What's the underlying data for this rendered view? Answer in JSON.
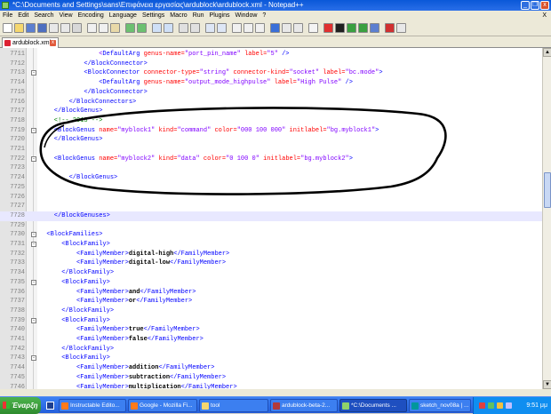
{
  "window": {
    "title": "*C:\\Documents and Settings\\sans\\Επιφάνεια εργασίας\\ardublock\\ardublock.xml - Notepad++",
    "controls": [
      "_",
      "❐",
      "x"
    ]
  },
  "menu": {
    "items": [
      "File",
      "Edit",
      "Search",
      "View",
      "Encoding",
      "Language",
      "Settings",
      "Macro",
      "Run",
      "Plugins",
      "Window",
      "?"
    ],
    "close_doc": "X"
  },
  "tab": {
    "label": "ardublock.xml",
    "close": "x"
  },
  "editor": {
    "lines": [
      {
        "n": "7711",
        "fold": "",
        "segs": [
          {
            "c": "val",
            "t": "                <"
          },
          {
            "c": "tag",
            "t": "DefaultArg "
          },
          {
            "c": "attr",
            "t": "genus-name="
          },
          {
            "c": "val",
            "t": "\"port_pin_name\" "
          },
          {
            "c": "attr",
            "t": "label="
          },
          {
            "c": "val",
            "t": "\"5\" "
          },
          {
            "c": "tag",
            "t": "/>"
          }
        ]
      },
      {
        "n": "7712",
        "fold": "",
        "segs": [
          {
            "c": "tag",
            "t": "            </BlockConnector>"
          }
        ]
      },
      {
        "n": "7713",
        "fold": "-",
        "segs": [
          {
            "c": "tag",
            "t": "            <BlockConnector "
          },
          {
            "c": "attr",
            "t": "connector-type="
          },
          {
            "c": "val",
            "t": "\"string\" "
          },
          {
            "c": "attr",
            "t": "connector-kind="
          },
          {
            "c": "val",
            "t": "\"socket\" "
          },
          {
            "c": "attr",
            "t": "label="
          },
          {
            "c": "val",
            "t": "\"bc.mode\""
          },
          {
            "c": "tag",
            "t": ">"
          }
        ]
      },
      {
        "n": "7714",
        "fold": "",
        "segs": [
          {
            "c": "tag",
            "t": "                <DefaultArg "
          },
          {
            "c": "attr",
            "t": "genus-name="
          },
          {
            "c": "val",
            "t": "\"output_mode_highpulse\" "
          },
          {
            "c": "attr",
            "t": "label="
          },
          {
            "c": "val",
            "t": "\"High Pulse\" "
          },
          {
            "c": "tag",
            "t": "/>"
          }
        ]
      },
      {
        "n": "7715",
        "fold": "",
        "segs": [
          {
            "c": "tag",
            "t": "            </BlockConnector>"
          }
        ]
      },
      {
        "n": "7716",
        "fold": "",
        "segs": [
          {
            "c": "tag",
            "t": "        </BlockConnectors>"
          }
        ]
      },
      {
        "n": "7717",
        "fold": "",
        "segs": [
          {
            "c": "tag",
            "t": "    </BlockGenus>"
          }
        ]
      },
      {
        "n": "7718",
        "fold": "",
        "segs": [
          {
            "c": "cmt",
            "t": "    <!-- 2013 -->"
          }
        ]
      },
      {
        "n": "7719",
        "fold": "-",
        "segs": [
          {
            "c": "tag",
            "t": "    <BlockGenus "
          },
          {
            "c": "attr",
            "t": "name="
          },
          {
            "c": "val",
            "t": "\"myblock1\" "
          },
          {
            "c": "attr",
            "t": "kind="
          },
          {
            "c": "val",
            "t": "\"command\" "
          },
          {
            "c": "attr",
            "t": "color="
          },
          {
            "c": "val",
            "t": "\"000 100 000\" "
          },
          {
            "c": "attr",
            "t": "initlabel="
          },
          {
            "c": "val",
            "t": "\"bg.myblock1\""
          },
          {
            "c": "tag",
            "t": ">"
          }
        ]
      },
      {
        "n": "7720",
        "fold": "",
        "segs": [
          {
            "c": "tag",
            "t": "    </BlockGenus>"
          }
        ]
      },
      {
        "n": "7721",
        "fold": "",
        "segs": []
      },
      {
        "n": "7722",
        "fold": "-",
        "segs": [
          {
            "c": "tag",
            "t": "    <BlockGenus "
          },
          {
            "c": "attr",
            "t": "name="
          },
          {
            "c": "val",
            "t": "\"myblock2\" "
          },
          {
            "c": "attr",
            "t": "kind="
          },
          {
            "c": "val",
            "t": "\"data\" "
          },
          {
            "c": "attr",
            "t": "color="
          },
          {
            "c": "val",
            "t": "\"0 100 0\" "
          },
          {
            "c": "attr",
            "t": "initlabel="
          },
          {
            "c": "val",
            "t": "\"bg.myblock2\""
          },
          {
            "c": "tag",
            "t": ">"
          }
        ]
      },
      {
        "n": "7723",
        "fold": "",
        "segs": []
      },
      {
        "n": "7724",
        "fold": "",
        "segs": [
          {
            "c": "tag",
            "t": "        </BlockGenus>"
          }
        ]
      },
      {
        "n": "7725",
        "fold": "",
        "segs": []
      },
      {
        "n": "7726",
        "fold": "",
        "segs": []
      },
      {
        "n": "7727",
        "fold": "",
        "segs": []
      },
      {
        "n": "7728",
        "fold": "",
        "segs": [
          {
            "c": "tag",
            "t": "    </BlockGenuses>"
          }
        ]
      },
      {
        "n": "7729",
        "fold": "",
        "segs": []
      },
      {
        "n": "7730",
        "fold": "-",
        "segs": [
          {
            "c": "tag",
            "t": "  <BlockFamilies>"
          }
        ]
      },
      {
        "n": "7731",
        "fold": "-",
        "segs": [
          {
            "c": "tag",
            "t": "      <BlockFamily>"
          }
        ]
      },
      {
        "n": "7732",
        "fold": "",
        "segs": [
          {
            "c": "tag",
            "t": "          <FamilyMember>"
          },
          {
            "c": "txt",
            "t": "digital-high"
          },
          {
            "c": "tag",
            "t": "</FamilyMember>"
          }
        ]
      },
      {
        "n": "7733",
        "fold": "",
        "segs": [
          {
            "c": "tag",
            "t": "          <FamilyMember>"
          },
          {
            "c": "txt",
            "t": "digital-low"
          },
          {
            "c": "tag",
            "t": "</FamilyMember>"
          }
        ]
      },
      {
        "n": "7734",
        "fold": "",
        "segs": [
          {
            "c": "tag",
            "t": "      </BlockFamily>"
          }
        ]
      },
      {
        "n": "7735",
        "fold": "-",
        "segs": [
          {
            "c": "tag",
            "t": "      <BlockFamily>"
          }
        ]
      },
      {
        "n": "7736",
        "fold": "",
        "segs": [
          {
            "c": "tag",
            "t": "          <FamilyMember>"
          },
          {
            "c": "txt",
            "t": "and"
          },
          {
            "c": "tag",
            "t": "</FamilyMember>"
          }
        ]
      },
      {
        "n": "7737",
        "fold": "",
        "segs": [
          {
            "c": "tag",
            "t": "          <FamilyMember>"
          },
          {
            "c": "txt",
            "t": "or"
          },
          {
            "c": "tag",
            "t": "</FamilyMember>"
          }
        ]
      },
      {
        "n": "7738",
        "fold": "",
        "segs": [
          {
            "c": "tag",
            "t": "      </BlockFamily>"
          }
        ]
      },
      {
        "n": "7739",
        "fold": "-",
        "segs": [
          {
            "c": "tag",
            "t": "      <BlockFamily>"
          }
        ]
      },
      {
        "n": "7740",
        "fold": "",
        "segs": [
          {
            "c": "tag",
            "t": "          <FamilyMember>"
          },
          {
            "c": "txt",
            "t": "true"
          },
          {
            "c": "tag",
            "t": "</FamilyMember>"
          }
        ]
      },
      {
        "n": "7741",
        "fold": "",
        "segs": [
          {
            "c": "tag",
            "t": "          <FamilyMember>"
          },
          {
            "c": "txt",
            "t": "false"
          },
          {
            "c": "tag",
            "t": "</FamilyMember>"
          }
        ]
      },
      {
        "n": "7742",
        "fold": "",
        "segs": [
          {
            "c": "tag",
            "t": "      </BlockFamily>"
          }
        ]
      },
      {
        "n": "7743",
        "fold": "-",
        "segs": [
          {
            "c": "tag",
            "t": "      <BlockFamily>"
          }
        ]
      },
      {
        "n": "7744",
        "fold": "",
        "segs": [
          {
            "c": "tag",
            "t": "          <FamilyMember>"
          },
          {
            "c": "txt",
            "t": "addition"
          },
          {
            "c": "tag",
            "t": "</FamilyMember>"
          }
        ]
      },
      {
        "n": "7745",
        "fold": "",
        "segs": [
          {
            "c": "tag",
            "t": "          <FamilyMember>"
          },
          {
            "c": "txt",
            "t": "subtraction"
          },
          {
            "c": "tag",
            "t": "</FamilyMember>"
          }
        ]
      },
      {
        "n": "7746",
        "fold": "",
        "segs": [
          {
            "c": "tag",
            "t": "          <FamilyMember>"
          },
          {
            "c": "txt",
            "t": "multiplication"
          },
          {
            "c": "tag",
            "t": "</FamilyMember>"
          }
        ]
      }
    ],
    "current_line": "7728"
  },
  "taskbar": {
    "start_label": "Έναρξη",
    "items": [
      {
        "label": "Instructable Edito...",
        "color": "#ff7a1a",
        "icon": "firefox-icon"
      },
      {
        "label": "Google - Mozilla Fi...",
        "color": "#ff7a1a",
        "icon": "firefox-icon"
      },
      {
        "label": "tool",
        "color": "#f5d76e",
        "icon": "folder-icon"
      },
      {
        "label": "ardublock-beta-2...",
        "color": "#b23a3a",
        "icon": "archive-icon"
      },
      {
        "label": "*C:\\Documents ...",
        "color": "#8fd16a",
        "icon": "notepad-icon"
      },
      {
        "label": "sketch_nov08a | ...",
        "color": "#00979c",
        "icon": "arduino-icon"
      }
    ],
    "clock": "9:51 μμ"
  },
  "colors": {
    "tag": "#0000ff",
    "attr": "#ff0000",
    "value": "#8000ff",
    "comment": "#008000"
  }
}
